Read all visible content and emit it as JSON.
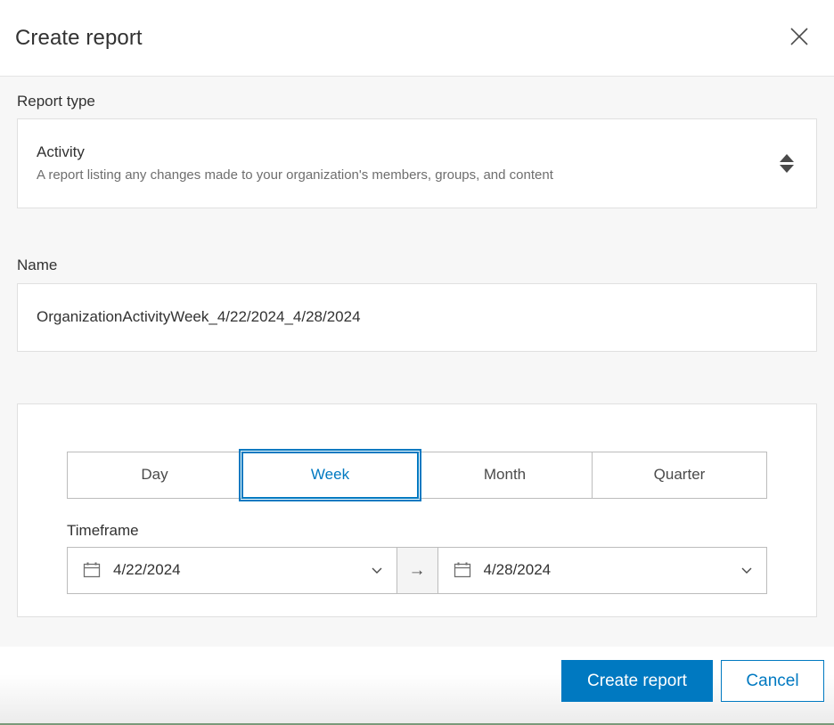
{
  "header": {
    "title": "Create report",
    "close_icon": "close-icon"
  },
  "report_type": {
    "label": "Report type",
    "selected_title": "Activity",
    "selected_description": "A report listing any changes made to your organization's members, groups, and content",
    "stepper_icon": "up-down-stepper-icon"
  },
  "name": {
    "label": "Name",
    "value": "OrganizationActivityWeek_4/22/2024_4/28/2024",
    "placeholder": "Report name"
  },
  "period": {
    "segments": [
      {
        "label": "Day",
        "selected": false
      },
      {
        "label": "Week",
        "selected": true
      },
      {
        "label": "Month",
        "selected": false
      },
      {
        "label": "Quarter",
        "selected": false
      }
    ],
    "timeframe_label": "Timeframe",
    "start_date": "4/22/2024",
    "end_date": "4/28/2024",
    "separator_glyph": "→",
    "calendar_icon": "calendar-icon",
    "chevron_icon": "chevron-down-icon"
  },
  "footer": {
    "primary_label": "Create report",
    "secondary_label": "Cancel"
  },
  "colors": {
    "accent": "#0079c1",
    "body_bg": "#f7f7f7",
    "card_bg": "#ffffff",
    "border": "#bcbcbc",
    "text": "#323232",
    "muted_text": "#6e6e6e",
    "bottom_rule": "#7a9a7a"
  }
}
